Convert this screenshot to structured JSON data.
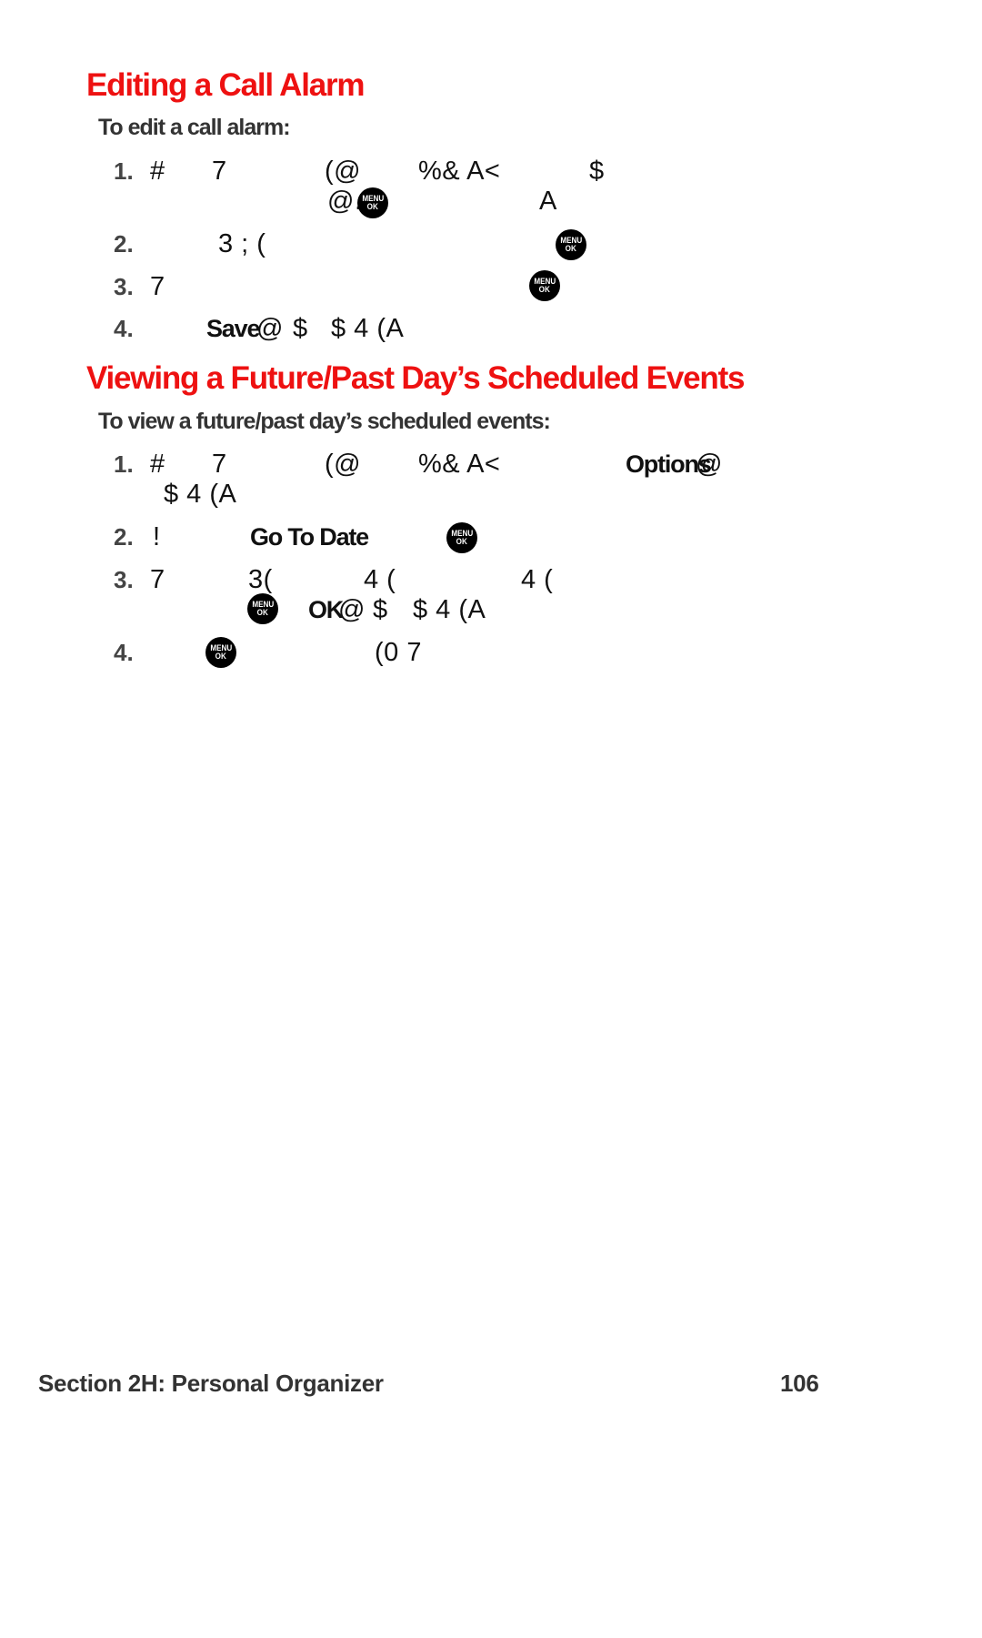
{
  "section1": {
    "title": "Editing a Call Alarm",
    "subtitle": "To edit a call alarm:",
    "steps": [
      {
        "num": "1.",
        "lines": [
          {
            "frag": [
              "#",
              "7",
              "(@",
              "%& A<",
              "$"
            ]
          },
          {
            "frag": [
              "@.",
              "A"
            ]
          }
        ]
      },
      {
        "num": "2.",
        "frag": [
          "3 ; ("
        ]
      },
      {
        "num": "3.",
        "frag": [
          "7"
        ]
      },
      {
        "num": "4.",
        "bold": "Save",
        "frag": [
          "@",
          "$",
          "$ 4 (A"
        ]
      }
    ]
  },
  "section2": {
    "title": "Viewing a Future/Past Day’s Scheduled Events",
    "subtitle": "To view a future/past day’s scheduled events:",
    "steps": [
      {
        "num": "1.",
        "frag": [
          "#",
          "7",
          "(@",
          "%& A<",
          "@"
        ],
        "bold": "Options",
        "line2": "$ 4 (A"
      },
      {
        "num": "2.",
        "frag": [
          "!"
        ],
        "bold": "Go To Date"
      },
      {
        "num": "3.",
        "frag": [
          "7",
          "3(",
          "4 (",
          "4 ("
        ],
        "bold": "OK",
        "line2": [
          "@",
          "$",
          "$ 4 (A"
        ]
      },
      {
        "num": "4.",
        "frag": [
          "(0 7"
        ]
      }
    ]
  },
  "icons": {
    "menu_ok_top": "MENU",
    "menu_ok_bottom": "OK"
  },
  "footer": {
    "section": "Section 2H: Personal Organizer",
    "page": "106"
  }
}
